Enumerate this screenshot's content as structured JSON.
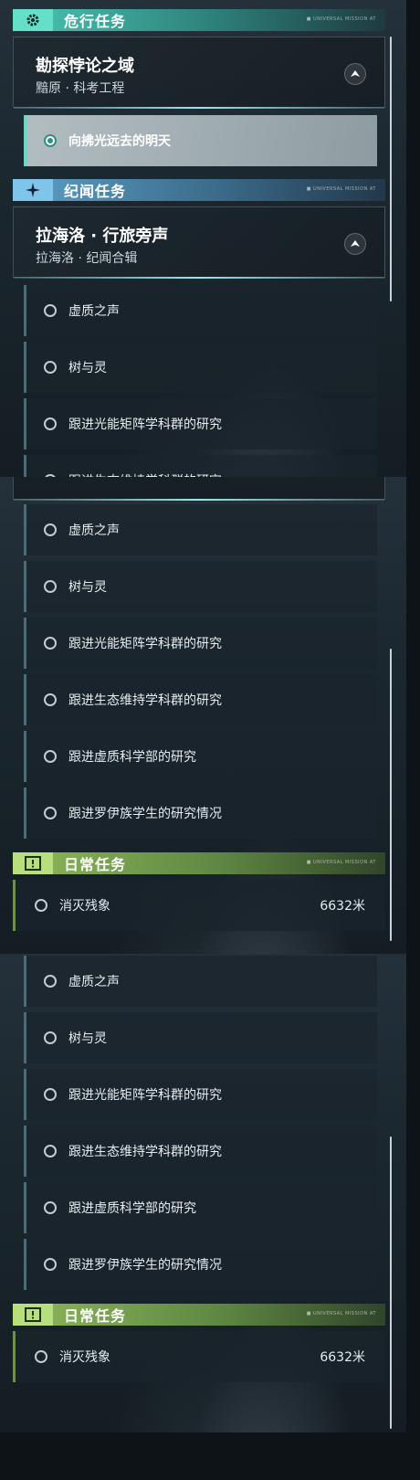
{
  "sections": {
    "danger": {
      "title": "危行任务",
      "icon": "gear-icon",
      "tagline": "■ UNIVERSAL MISSION AT"
    },
    "story": {
      "title": "纪闻任务",
      "icon": "sparkle-icon",
      "tagline": "■ UNIVERSAL MISSION AT"
    },
    "daily": {
      "title": "日常任务",
      "icon": "exclamation-icon",
      "tagline": "■ UNIVERSAL MISSION AT"
    }
  },
  "danger_mission": {
    "title": "勘探悖论之域",
    "subtitle": "黯原 · 科考工程",
    "active_task": "向拂光远去的明天"
  },
  "story_mission": {
    "title": "拉海洛 · 行旅旁声",
    "subtitle": "拉海洛 · 纪闻合辑"
  },
  "story_tasks": [
    "虚质之声",
    "树与灵",
    "跟进光能矩阵学科群的研究",
    "跟进生态维持学科群的研究",
    "跟进虚质科学部的研究",
    "跟进罗伊族学生的研究情况"
  ],
  "daily_task": {
    "label": "消灭残象",
    "distance": "6632米"
  },
  "colors": {
    "danger_accent": "#64e0c9",
    "story_accent": "#7fc4eb",
    "daily_accent": "#b7e07d"
  }
}
